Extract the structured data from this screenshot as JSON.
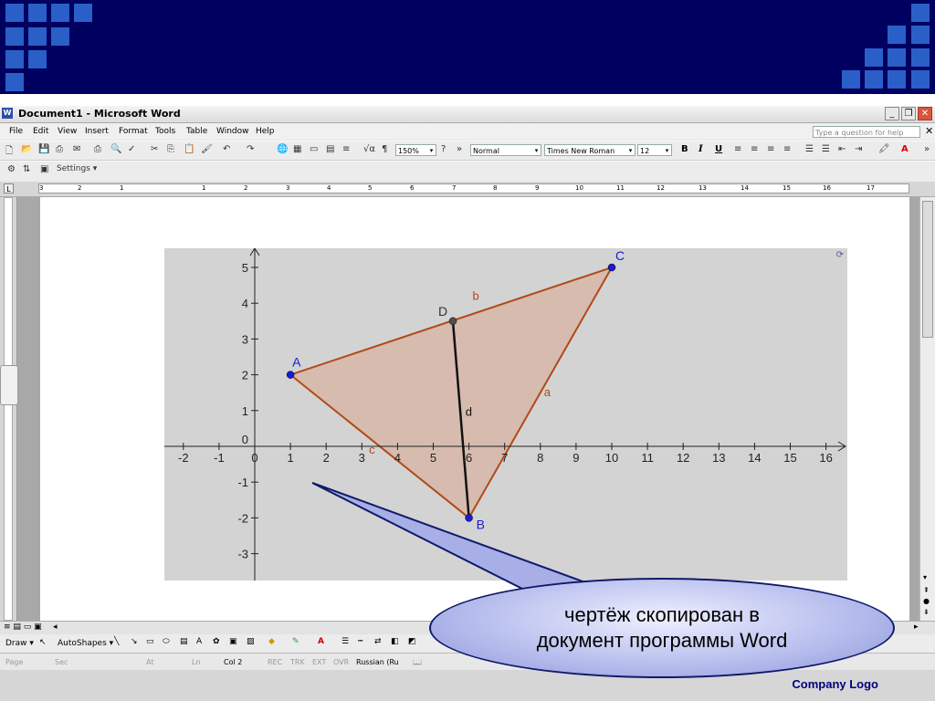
{
  "window": {
    "title": "Document1 - Microsoft Word"
  },
  "menu": [
    "File",
    "Edit",
    "View",
    "Insert",
    "Format",
    "Tools",
    "Table",
    "Window",
    "Help"
  ],
  "help_placeholder": "Type a question for help",
  "toolbar": {
    "zoom": "150%",
    "style": "Normal",
    "font": "Times New Roman",
    "size": "12",
    "settings": "Settings"
  },
  "ruler": {
    "h": [
      "3",
      "2",
      "1",
      "1",
      "2",
      "3",
      "4",
      "5",
      "6",
      "7",
      "8",
      "9",
      "10",
      "11",
      "12",
      "13",
      "14",
      "15",
      "16",
      "17"
    ]
  },
  "graph": {
    "x_ticks": [
      "-2",
      "-1",
      "0",
      "1",
      "2",
      "3",
      "4",
      "5",
      "6",
      "7",
      "8",
      "9",
      "10",
      "11",
      "12",
      "13",
      "14",
      "15",
      "16"
    ],
    "y_ticks": [
      "5",
      "4",
      "3",
      "2",
      "1",
      "0",
      "-1",
      "-2",
      "-3"
    ],
    "points": {
      "A": "A",
      "B": "B",
      "C": "C",
      "D": "D"
    },
    "segments": {
      "a": "a",
      "b": "b",
      "c": "c",
      "d": "d"
    }
  },
  "drawbar": {
    "draw": "Draw",
    "autoshapes": "AutoShapes"
  },
  "status": {
    "page": "Page",
    "sec": "Sec",
    "at": "At",
    "ln": "Ln",
    "col": "Col 2",
    "rec": "REC",
    "trk": "TRK",
    "ext": "EXT",
    "ovr": "OVR",
    "lang": "Russian (Ru"
  },
  "callout": {
    "line1": "чертёж скопирован в",
    "line2": "документ программы Word"
  },
  "footer": {
    "company": "Company  Logo"
  },
  "colors": {
    "banner": "#000060",
    "squares": "#2a5fc8",
    "triangle_fill": "#d8a890",
    "triangle_stroke": "#b04a16",
    "point": "#1a1ad8",
    "point_d": "#505050"
  }
}
